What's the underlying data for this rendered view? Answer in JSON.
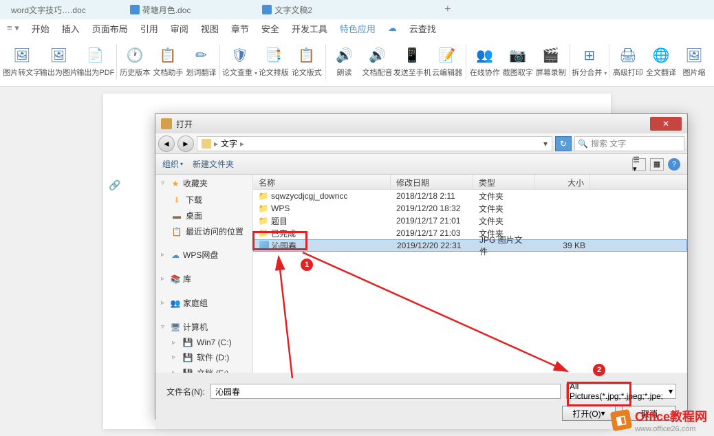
{
  "tabs": {
    "tab1": "word文字技巧….doc",
    "tab2": "荷塘月色.doc",
    "tab3": "文字文稿2"
  },
  "menu": {
    "items": [
      "开始",
      "插入",
      "页面布局",
      "引用",
      "审阅",
      "视图",
      "章节",
      "安全",
      "开发工具",
      "特色应用",
      "云查找"
    ],
    "active_index": 9
  },
  "ribbon": [
    {
      "label": "图片转文字",
      "icon": "🖼"
    },
    {
      "label": "输出为图片",
      "icon": "🖼"
    },
    {
      "label": "输出为PDF",
      "icon": "📄"
    },
    {
      "label": "历史版本",
      "icon": "🕐"
    },
    {
      "label": "文档助手",
      "icon": "📋"
    },
    {
      "label": "划词翻译",
      "icon": "✏"
    },
    {
      "label": "论文查重",
      "icon": "🛡"
    },
    {
      "label": "论文排版",
      "icon": "📑"
    },
    {
      "label": "论文版式",
      "icon": "📋"
    },
    {
      "label": "朗读",
      "icon": "🔊"
    },
    {
      "label": "文档配音",
      "icon": "🔊"
    },
    {
      "label": "发送至手机",
      "icon": "📱"
    },
    {
      "label": "云编辑器",
      "icon": "📝"
    },
    {
      "label": "在线协作",
      "icon": "👥"
    },
    {
      "label": "截图取字",
      "icon": "📷"
    },
    {
      "label": "屏幕录制",
      "icon": "🎬"
    },
    {
      "label": "拆分合并",
      "icon": "⊞"
    },
    {
      "label": "高级打印",
      "icon": "🖨"
    },
    {
      "label": "全文翻译",
      "icon": "🌐"
    },
    {
      "label": "图片缩",
      "icon": "🖼"
    }
  ],
  "dialog": {
    "title": "打开",
    "breadcrumb": "文字",
    "search_placeholder": "搜索 文字",
    "toolbar": {
      "organize": "组织",
      "newfolder": "新建文件夹"
    },
    "sidebar": {
      "favorites": "收藏夹",
      "downloads": "下载",
      "desktop": "桌面",
      "recent": "最近访问的位置",
      "wpsdisk": "WPS网盘",
      "library": "库",
      "homegroup": "家庭组",
      "computer": "计算机",
      "disk_c": "Win7 (C:)",
      "disk_d": "软件 (D:)",
      "disk_e": "文档 (E:)"
    },
    "columns": {
      "name": "名称",
      "date": "修改日期",
      "type": "类型",
      "size": "大小"
    },
    "files": [
      {
        "name": "sqwzycdjcgj_downcc",
        "date": "2018/12/18 2:11",
        "type": "文件夹",
        "size": "",
        "icon": "folder"
      },
      {
        "name": "WPS",
        "date": "2019/12/20 18:32",
        "type": "文件夹",
        "size": "",
        "icon": "folder"
      },
      {
        "name": "题目",
        "date": "2019/12/17 21:01",
        "type": "文件夹",
        "size": "",
        "icon": "folder"
      },
      {
        "name": "已完成",
        "date": "2019/12/17 21:03",
        "type": "文件夹",
        "size": "",
        "icon": "folder"
      },
      {
        "name": "沁园春",
        "date": "2019/12/20 22:31",
        "type": "JPG 图片文件",
        "size": "39 KB",
        "icon": "image",
        "selected": true
      }
    ],
    "filename_label": "文件名(N):",
    "filename_value": "沁园春",
    "filter": "All Pictures(*.jpg;*.jpeg;*.jpe;",
    "open_btn": "打开(O)",
    "cancel_btn": "取消"
  },
  "watermark": {
    "brand": "Office教程网",
    "url": "www.office26.com"
  },
  "annotations": {
    "num1": "1",
    "num2": "2"
  }
}
